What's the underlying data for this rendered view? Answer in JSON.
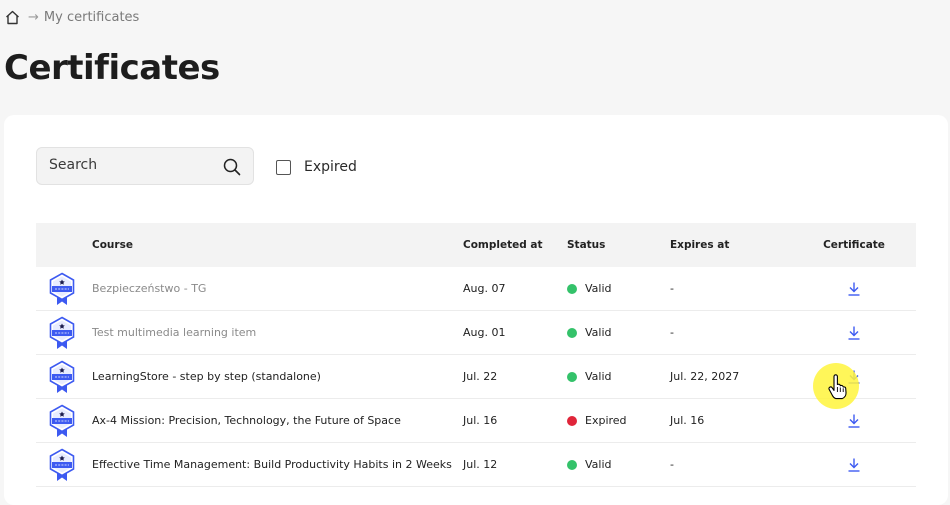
{
  "breadcrumb": {
    "current": "My certificates"
  },
  "page": {
    "title": "Certificates"
  },
  "filters": {
    "search_placeholder": "Search",
    "expired_label": "Expired"
  },
  "table": {
    "headers": {
      "course": "Course",
      "completed": "Completed at",
      "status": "Status",
      "expires": "Expires at",
      "certificate": "Certificate"
    },
    "rows": [
      {
        "course": "Bezpieczeństwo - TG",
        "completed": "Aug. 07",
        "status": "Valid",
        "expires": "-"
      },
      {
        "course": "Test multimedia learning item",
        "completed": "Aug. 01",
        "status": "Valid",
        "expires": "-"
      },
      {
        "course": "LearningStore - step by step (standalone)",
        "completed": "Jul. 22",
        "status": "Valid",
        "expires": "Jul. 22, 2027"
      },
      {
        "course": "Ax-4 Mission: Precision, Technology, the Future of Space",
        "completed": "Jul. 16",
        "status": "Expired",
        "expires": "Jul. 16"
      },
      {
        "course": "Effective Time Management: Build Productivity Habits in 2 Weeks",
        "completed": "Jul. 12",
        "status": "Valid",
        "expires": "-"
      }
    ]
  },
  "colors": {
    "valid": "#34c26a",
    "expired": "#e0253a",
    "accent": "#3d5af1",
    "cursor_highlight": "#fff53c"
  },
  "icons": {
    "home": "home-icon",
    "search": "search-icon",
    "badge": "certificate-badge-icon",
    "download": "download-icon",
    "cursor": "hand-pointer-cursor"
  }
}
